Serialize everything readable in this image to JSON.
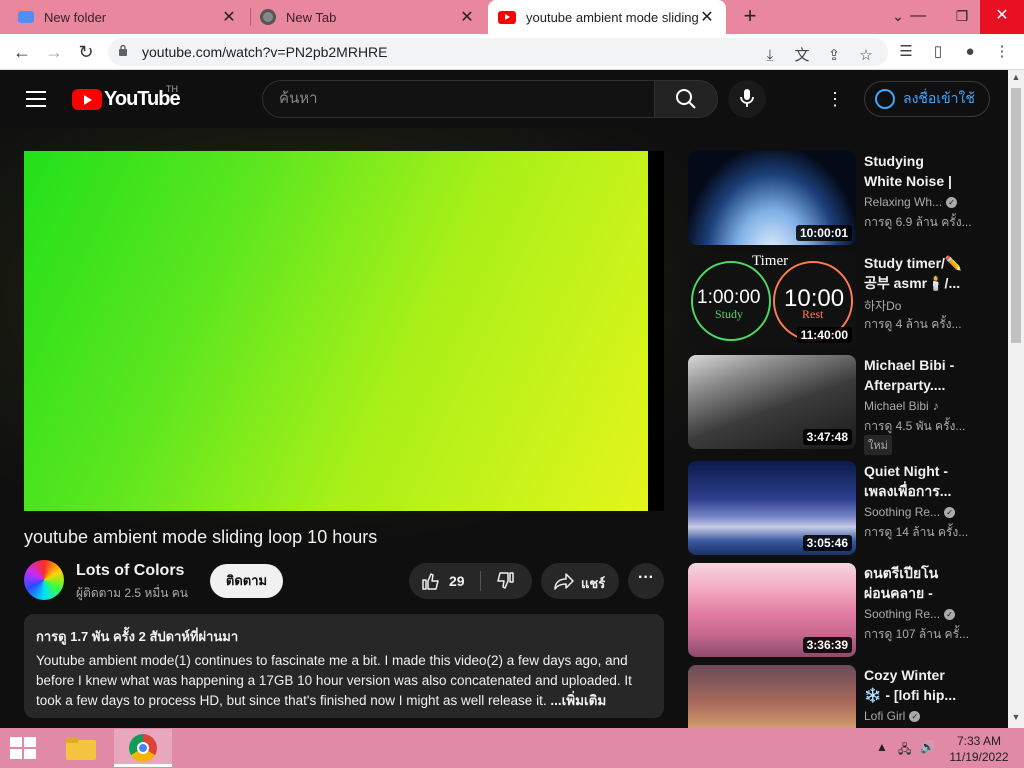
{
  "browser": {
    "tabs": [
      {
        "title": "New folder",
        "icon": "folder-tab-icon"
      },
      {
        "title": "New Tab",
        "icon": "chrome-icon"
      },
      {
        "title": "youtube ambient mode sliding lo",
        "icon": "youtube-icon",
        "active": true
      }
    ],
    "new_tab": "+",
    "url": "youtube.com/watch?v=PN2pb2MRHRE"
  },
  "youtube": {
    "logo_text": "YouTube",
    "country_code": "TH",
    "search_placeholder": "ค้นหา",
    "signin_label": "ลงชื่อเข้าใช้"
  },
  "video": {
    "title": "youtube ambient mode sliding loop 10 hours",
    "channel": "Lots of Colors",
    "subscribers": "ผู้ติดตาม 2.5 หมื่น คน",
    "subscribe_label": "ติดตาม",
    "likes": "29",
    "share_label": "แชร์",
    "more_label": "···",
    "description": {
      "meta": "การดู 1.7 พัน ครั้ง  2 สัปดาห์ที่ผ่านมา",
      "text": "Youtube ambient mode(1) continues to fascinate me a bit. I made this video(2) a few days ago, and before I knew what was happening a 17GB 10 hour version was also concatenated and uploaded. It took a few days to process HD, but since that's finished now I might as well release it.",
      "more": " ...เพิ่มเติม"
    }
  },
  "related": [
    {
      "title": "Studying White Noise | Focus...",
      "channel": "Relaxing Wh...",
      "verified": true,
      "views": "การดู 6.9 ล้าน ครั้ง...",
      "duration": "10:00:01"
    },
    {
      "title": "Study timer/✏️ 공부 asmr🕯️/...",
      "channel": "하자Do",
      "verified": false,
      "views": "การดู 4 ล้าน ครั้ง...",
      "duration": "11:40:00",
      "thumb_text": {
        "label": "Timer",
        "left": "1:00:00",
        "left_sub": "Study",
        "right": "10:00",
        "right_sub": "Rest"
      }
    },
    {
      "title": "Michael Bibi - Afterparty....",
      "channel": "Michael Bibi",
      "music": true,
      "views": "การดู 4.5 พัน ครั้ง...",
      "badge": "ใหม่",
      "duration": "3:47:48"
    },
    {
      "title": "Quiet Night - เพลงเพื่อการ...",
      "channel": "Soothing Re...",
      "verified": true,
      "views": "การดู 14 ล้าน ครั้ง...",
      "duration": "3:05:46"
    },
    {
      "title": "ดนตรีเปียโนผ่อนคลาย - ดนตรี...",
      "channel": "Soothing Re...",
      "verified": true,
      "views": "การดู 107 ล้าน ครั้...",
      "duration": "3:36:39"
    },
    {
      "title": "Cozy Winter ❄️ - [lofi hip...",
      "channel": "Lofi Girl",
      "verified": true,
      "views": "",
      "duration": ""
    }
  ],
  "taskbar": {
    "time": "7:33 AM",
    "date": "11/19/2022"
  },
  "colors": {
    "tabstrip": "#e9879e",
    "yt_bg": "#0f0f0f",
    "signin_blue": "#3ea6ff",
    "taskbar": "#e18aa7"
  }
}
